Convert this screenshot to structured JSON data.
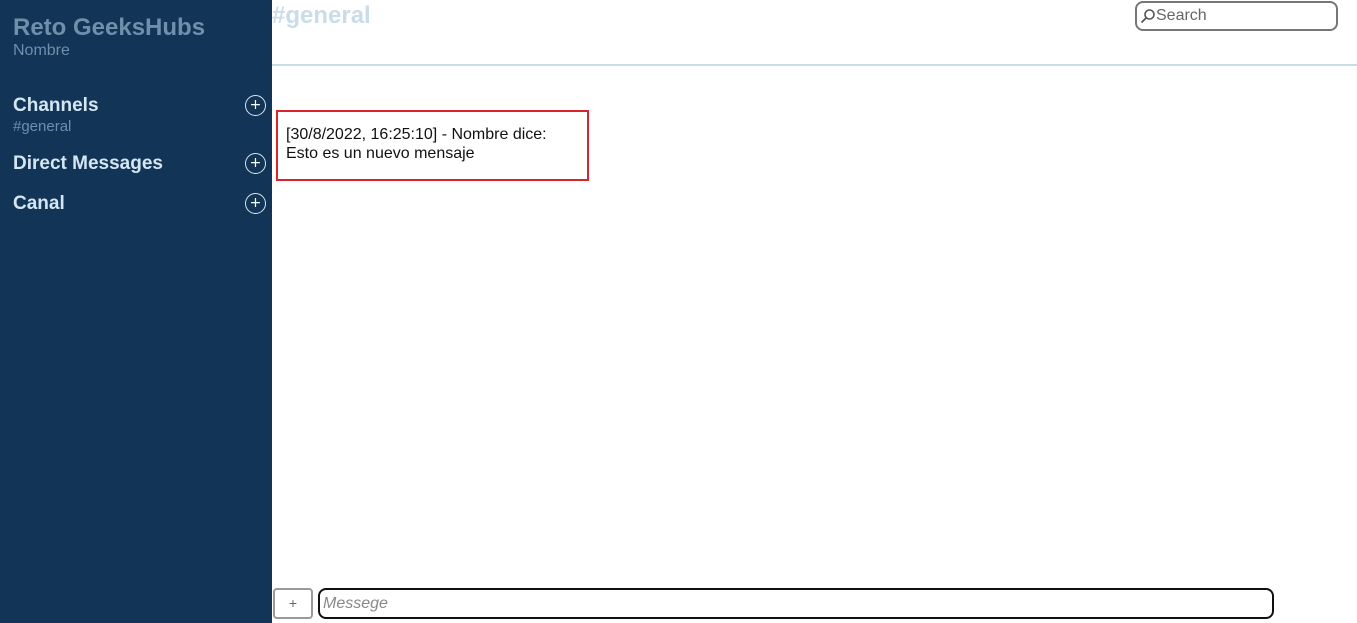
{
  "sidebar": {
    "workspace_name": "Reto GeeksHubs",
    "user_name": "Nombre",
    "sections": [
      {
        "title": "Channels",
        "add_label": "+",
        "items": [
          "#general"
        ]
      },
      {
        "title": "Direct Messages",
        "add_label": "+"
      },
      {
        "title": "Canal",
        "add_label": "+"
      }
    ]
  },
  "header": {
    "channel_title": "#general",
    "search": {
      "placeholder": "Search",
      "icon": "search-icon"
    }
  },
  "messages": [
    {
      "meta": "[30/8/2022, 16:25:10] - Nombre dice:",
      "text": "Esto es un nuevo mensaje"
    }
  ],
  "composer": {
    "attach_label": "+",
    "placeholder": "Messege"
  },
  "colors": {
    "sidebar_bg": "#123456",
    "message_border": "#d9232d",
    "header_text": "#c9dde9"
  }
}
